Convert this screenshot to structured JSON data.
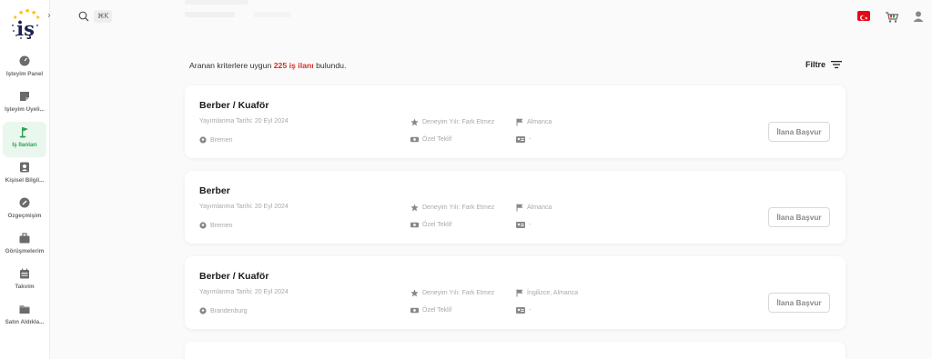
{
  "app": {
    "logo_text": "iş"
  },
  "sidebar": {
    "items": [
      {
        "label": "İşteyim Panel",
        "icon": "gauge-icon"
      },
      {
        "label": "İşteyim Üyeli...",
        "icon": "membership-card-icon"
      },
      {
        "label": "İş İlanları",
        "icon": "flag-icon",
        "active": true
      },
      {
        "label": "Kişisel Bilgil...",
        "icon": "id-badge-icon"
      },
      {
        "label": "Özgeçmişim",
        "icon": "resume-icon"
      },
      {
        "label": "Görüşmelerim",
        "icon": "briefcase-icon"
      },
      {
        "label": "Takvim",
        "icon": "calendar-icon"
      },
      {
        "label": "Satın Aldıkla...",
        "icon": "folder-icon"
      }
    ]
  },
  "topbar": {
    "search_shortcut": "⌘K",
    "flag_icon": "turkey-flag-icon",
    "cart_icon": "cart-icon",
    "user_icon": "user-icon"
  },
  "results": {
    "prefix": "Aranan kriterlere uygun ",
    "count": "225 iş ilanı",
    "suffix": " bulundu.",
    "filter_label": "Filtre"
  },
  "jobs": [
    {
      "title": "Berber / Kuaför",
      "date": "Yayımlanma Tarihi: 20 Eyl 2024",
      "location": "Bremen",
      "experience": "Deneyim Yılı: Fark Etmez",
      "offer": "Özel Teklif",
      "languages": "Almanca",
      "id_value": "-",
      "apply_label": "İlana Başvur"
    },
    {
      "title": "Berber",
      "date": "Yayımlanma Tarihi: 20 Eyl 2024",
      "location": "Bremen",
      "experience": "Deneyim Yılı: Fark Etmez",
      "offer": "Özel Teklif",
      "languages": "Almanca",
      "id_value": "-",
      "apply_label": "İlana Başvur"
    },
    {
      "title": "Berber / Kuaför",
      "date": "Yayımlanma Tarihi: 20 Eyl 2024",
      "location": "Brandenburg",
      "experience": "Deneyim Yılı: Fark Etmez",
      "offer": "Özel Teklif",
      "languages": "İngilizce, Almanca",
      "id_value": "-",
      "apply_label": "İlana Başvur"
    }
  ],
  "colors": {
    "accent_green": "#2aa053",
    "count_red": "#d93025",
    "brand_navy": "#1b2451",
    "star_gold": "#f2b800"
  }
}
